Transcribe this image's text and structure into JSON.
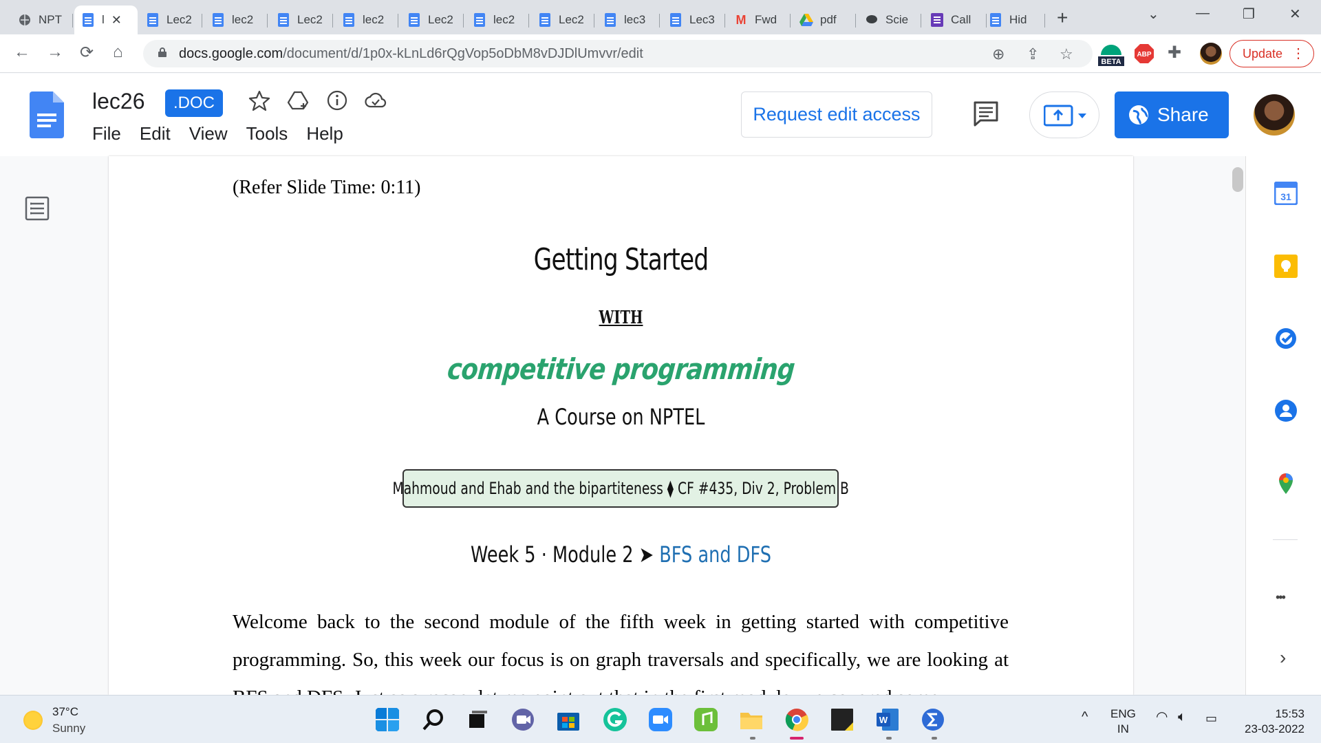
{
  "browser": {
    "tabs": [
      {
        "label": "NPT",
        "icon": "globe-icon"
      },
      {
        "label": "l",
        "icon": "docs-icon",
        "active": true
      },
      {
        "label": "Lec2",
        "icon": "docs-icon"
      },
      {
        "label": "lec2",
        "icon": "docs-icon"
      },
      {
        "label": "Lec2",
        "icon": "docs-icon"
      },
      {
        "label": "lec2",
        "icon": "docs-icon"
      },
      {
        "label": "Lec2",
        "icon": "docs-icon"
      },
      {
        "label": "lec2",
        "icon": "docs-icon"
      },
      {
        "label": "Lec2",
        "icon": "docs-icon"
      },
      {
        "label": "lec3",
        "icon": "docs-icon"
      },
      {
        "label": "Lec3",
        "icon": "docs-icon"
      },
      {
        "label": "Fwd",
        "icon": "gmail-icon"
      },
      {
        "label": "pdf",
        "icon": "drive-icon"
      },
      {
        "label": "Scie",
        "icon": "chat-icon"
      },
      {
        "label": "Call",
        "icon": "forms-icon"
      },
      {
        "label": "Hid",
        "icon": "docs-icon"
      }
    ],
    "url_domain": "docs.google.com",
    "url_path": "/document/d/1p0x-kLnLd6rQgVop5oDbM8vDJDlUmvvr/edit",
    "extension_badge": "BETA",
    "abp_label": "ABP",
    "update_label": "Update"
  },
  "docs": {
    "title": "lec26",
    "badge": ".DOC",
    "menu": [
      "File",
      "Edit",
      "View",
      "Tools",
      "Help"
    ],
    "request_edit": "Request edit access",
    "share": "Share"
  },
  "document": {
    "refer_time": "(Refer Slide Time: 0:11)",
    "slide": {
      "title": "Getting Started",
      "with": "WITH",
      "subtitle": "competitive programming",
      "course": "A Course on NPTEL",
      "problem": "Mahmoud and Ehab and the bipartiteness ⧫ CF #435, Div 2, Problem B",
      "week": "Week 5 · Module 2 ➤ ",
      "topic": "BFS and DFS"
    },
    "paragraph": "Welcome back to the second module of the fifth week in getting started with competitive programming. So, this week our focus is on graph traversals and specifically, we are looking at BFS and DFS. Just as a recap, let me point out that in the first module, we covered some"
  },
  "side_panel": {
    "calendar_day": "31",
    "more": "•••"
  },
  "taskbar": {
    "temperature": "37°C",
    "weather": "Sunny",
    "lang_top": "ENG",
    "lang_bottom": "IN",
    "time": "15:53",
    "date": "23-03-2022"
  },
  "colors": {
    "accent": "#1a73e8",
    "slide_green": "#2aa36e",
    "slide_box": "#e2f1e4",
    "update_red": "#d93025"
  }
}
